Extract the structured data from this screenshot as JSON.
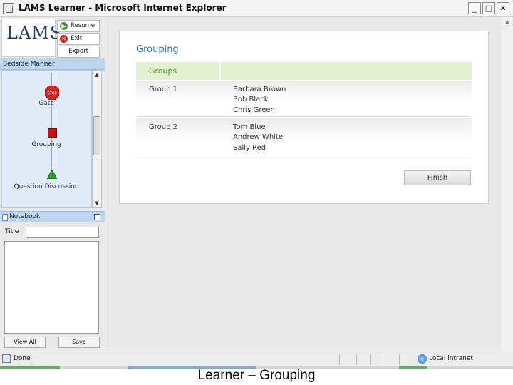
{
  "window": {
    "title": "LAMS Learner - Microsoft Internet Explorer"
  },
  "window_controls": {
    "minimize": "_",
    "maximize": "□",
    "close": "✕"
  },
  "left_panel": {
    "logo": "LAMS",
    "controls": {
      "resume": "Resume",
      "exit": "Exit",
      "export": "Export"
    },
    "learner_name": "Bedside Manner",
    "activities": [
      {
        "label": "Gate",
        "icon": "stop-sign-icon",
        "stop_text": "STOP"
      },
      {
        "label": "Grouping",
        "icon": "red-square-icon"
      },
      {
        "label": "Question Discussion",
        "icon": "green-triangle-icon"
      }
    ],
    "notebook": {
      "header": "Notebook",
      "title_label": "Title",
      "title_value": "",
      "body_value": "",
      "view_all": "View All",
      "save": "Save"
    }
  },
  "main": {
    "title": "Grouping",
    "groups_header": "Groups",
    "groups": [
      {
        "name": "Group 1",
        "members": [
          "Barbara Brown",
          "Bob Black",
          "Chris Green"
        ]
      },
      {
        "name": "Group 2",
        "members": [
          "Tom Blue",
          "Andrew White",
          "Sally Red"
        ]
      }
    ],
    "finish": "Finish"
  },
  "statusbar": {
    "status": "Done",
    "zone": "Local intranet"
  },
  "caption": "Learner – Grouping",
  "colors": {
    "title_blue": "#2c6fb5",
    "groups_header_bg": "#e3f0cf",
    "groups_header_text": "#4a8a2e",
    "panel_header_blue": "#bcd6f0"
  }
}
